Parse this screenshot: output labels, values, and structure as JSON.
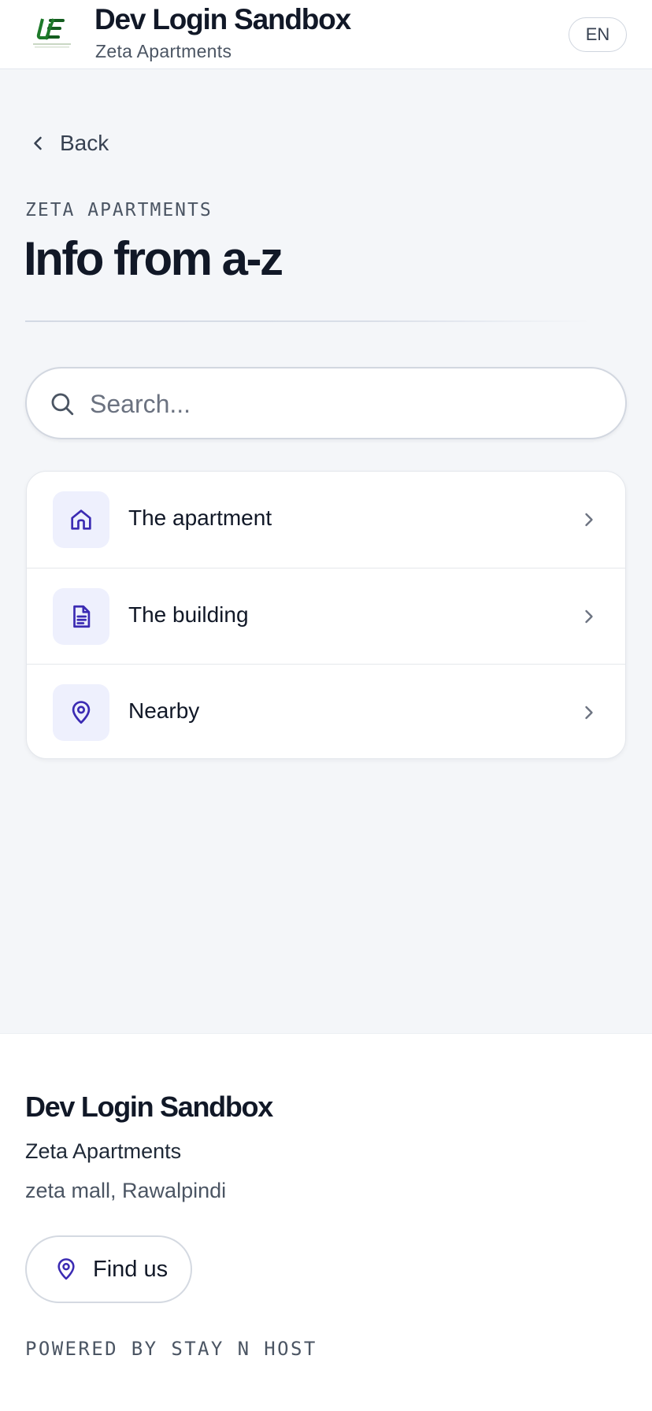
{
  "header": {
    "logo_text": "UE",
    "logo_caption": "URBAN ELAN",
    "title": "Dev Login Sandbox",
    "subtitle": "Zeta Apartments",
    "language": "EN"
  },
  "nav": {
    "back_label": "Back"
  },
  "page": {
    "eyebrow": "ZETA APARTMENTS",
    "title": "Info from a-z"
  },
  "search": {
    "placeholder": "Search...",
    "value": ""
  },
  "categories": [
    {
      "label": "The apartment",
      "icon": "home-icon"
    },
    {
      "label": "The building",
      "icon": "document-icon"
    },
    {
      "label": "Nearby",
      "icon": "map-pin-icon"
    }
  ],
  "footer": {
    "title": "Dev Login Sandbox",
    "subtitle": "Zeta Apartments",
    "address": "zeta mall, Rawalpindi",
    "find_us_label": "Find us",
    "powered_by": "POWERED BY STAY N HOST"
  },
  "colors": {
    "accent": "#3b2bb3",
    "icon_tile_bg": "#eef0fd",
    "page_bg": "#f4f6f9",
    "logo_green": "#1e7a2a"
  }
}
